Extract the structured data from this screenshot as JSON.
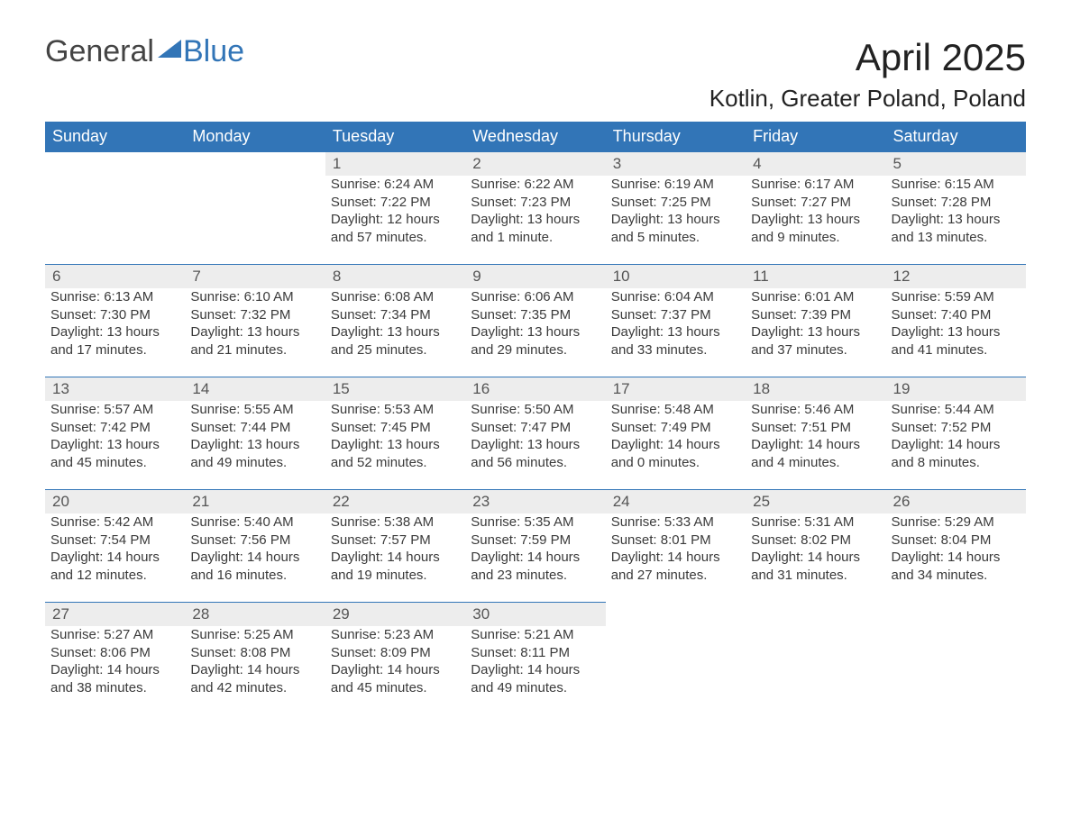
{
  "brand": {
    "word1": "General",
    "word2": "Blue"
  },
  "title": "April 2025",
  "location": "Kotlin, Greater Poland, Poland",
  "weekdays": [
    "Sunday",
    "Monday",
    "Tuesday",
    "Wednesday",
    "Thursday",
    "Friday",
    "Saturday"
  ],
  "labels": {
    "sunrise": "Sunrise:",
    "sunset": "Sunset:",
    "daylight": "Daylight:"
  },
  "weeks": [
    [
      null,
      null,
      {
        "d": "1",
        "sunrise": "6:24 AM",
        "sunset": "7:22 PM",
        "daylight": "12 hours and 57 minutes."
      },
      {
        "d": "2",
        "sunrise": "6:22 AM",
        "sunset": "7:23 PM",
        "daylight": "13 hours and 1 minute."
      },
      {
        "d": "3",
        "sunrise": "6:19 AM",
        "sunset": "7:25 PM",
        "daylight": "13 hours and 5 minutes."
      },
      {
        "d": "4",
        "sunrise": "6:17 AM",
        "sunset": "7:27 PM",
        "daylight": "13 hours and 9 minutes."
      },
      {
        "d": "5",
        "sunrise": "6:15 AM",
        "sunset": "7:28 PM",
        "daylight": "13 hours and 13 minutes."
      }
    ],
    [
      {
        "d": "6",
        "sunrise": "6:13 AM",
        "sunset": "7:30 PM",
        "daylight": "13 hours and 17 minutes."
      },
      {
        "d": "7",
        "sunrise": "6:10 AM",
        "sunset": "7:32 PM",
        "daylight": "13 hours and 21 minutes."
      },
      {
        "d": "8",
        "sunrise": "6:08 AM",
        "sunset": "7:34 PM",
        "daylight": "13 hours and 25 minutes."
      },
      {
        "d": "9",
        "sunrise": "6:06 AM",
        "sunset": "7:35 PM",
        "daylight": "13 hours and 29 minutes."
      },
      {
        "d": "10",
        "sunrise": "6:04 AM",
        "sunset": "7:37 PM",
        "daylight": "13 hours and 33 minutes."
      },
      {
        "d": "11",
        "sunrise": "6:01 AM",
        "sunset": "7:39 PM",
        "daylight": "13 hours and 37 minutes."
      },
      {
        "d": "12",
        "sunrise": "5:59 AM",
        "sunset": "7:40 PM",
        "daylight": "13 hours and 41 minutes."
      }
    ],
    [
      {
        "d": "13",
        "sunrise": "5:57 AM",
        "sunset": "7:42 PM",
        "daylight": "13 hours and 45 minutes."
      },
      {
        "d": "14",
        "sunrise": "5:55 AM",
        "sunset": "7:44 PM",
        "daylight": "13 hours and 49 minutes."
      },
      {
        "d": "15",
        "sunrise": "5:53 AM",
        "sunset": "7:45 PM",
        "daylight": "13 hours and 52 minutes."
      },
      {
        "d": "16",
        "sunrise": "5:50 AM",
        "sunset": "7:47 PM",
        "daylight": "13 hours and 56 minutes."
      },
      {
        "d": "17",
        "sunrise": "5:48 AM",
        "sunset": "7:49 PM",
        "daylight": "14 hours and 0 minutes."
      },
      {
        "d": "18",
        "sunrise": "5:46 AM",
        "sunset": "7:51 PM",
        "daylight": "14 hours and 4 minutes."
      },
      {
        "d": "19",
        "sunrise": "5:44 AM",
        "sunset": "7:52 PM",
        "daylight": "14 hours and 8 minutes."
      }
    ],
    [
      {
        "d": "20",
        "sunrise": "5:42 AM",
        "sunset": "7:54 PM",
        "daylight": "14 hours and 12 minutes."
      },
      {
        "d": "21",
        "sunrise": "5:40 AM",
        "sunset": "7:56 PM",
        "daylight": "14 hours and 16 minutes."
      },
      {
        "d": "22",
        "sunrise": "5:38 AM",
        "sunset": "7:57 PM",
        "daylight": "14 hours and 19 minutes."
      },
      {
        "d": "23",
        "sunrise": "5:35 AM",
        "sunset": "7:59 PM",
        "daylight": "14 hours and 23 minutes."
      },
      {
        "d": "24",
        "sunrise": "5:33 AM",
        "sunset": "8:01 PM",
        "daylight": "14 hours and 27 minutes."
      },
      {
        "d": "25",
        "sunrise": "5:31 AM",
        "sunset": "8:02 PM",
        "daylight": "14 hours and 31 minutes."
      },
      {
        "d": "26",
        "sunrise": "5:29 AM",
        "sunset": "8:04 PM",
        "daylight": "14 hours and 34 minutes."
      }
    ],
    [
      {
        "d": "27",
        "sunrise": "5:27 AM",
        "sunset": "8:06 PM",
        "daylight": "14 hours and 38 minutes."
      },
      {
        "d": "28",
        "sunrise": "5:25 AM",
        "sunset": "8:08 PM",
        "daylight": "14 hours and 42 minutes."
      },
      {
        "d": "29",
        "sunrise": "5:23 AM",
        "sunset": "8:09 PM",
        "daylight": "14 hours and 45 minutes."
      },
      {
        "d": "30",
        "sunrise": "5:21 AM",
        "sunset": "8:11 PM",
        "daylight": "14 hours and 49 minutes."
      },
      null,
      null,
      null
    ]
  ]
}
